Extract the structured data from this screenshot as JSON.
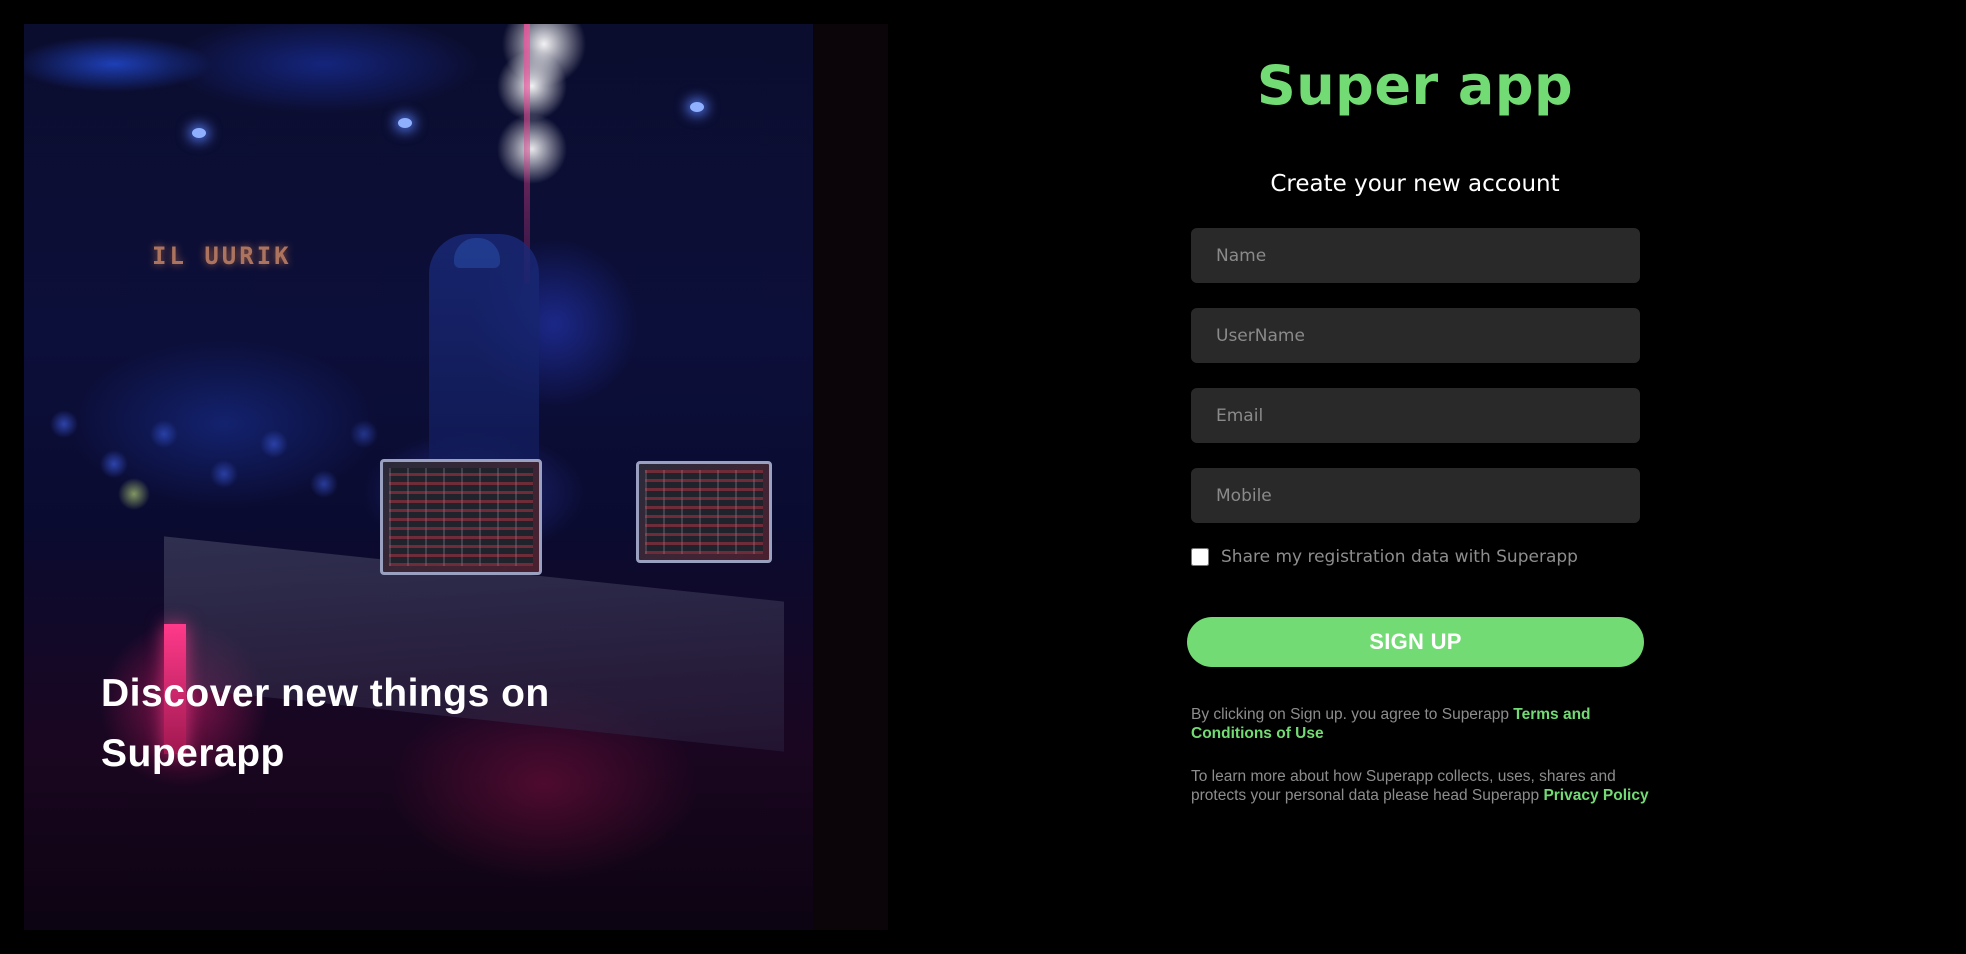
{
  "hero": {
    "title": "Discover new things on Superapp",
    "sign_text": "IL UURIK"
  },
  "brand": {
    "name": "Super app",
    "accent_color": "#72db73"
  },
  "form": {
    "subtitle": "Create your new account",
    "name_placeholder": "Name",
    "username_placeholder": "UserName",
    "email_placeholder": "Email",
    "mobile_placeholder": "Mobile",
    "share_label": "Share my registration data with Superapp",
    "share_checked": false,
    "signup_label": "SIGN UP"
  },
  "legal": {
    "terms_text": "By clicking on Sign up. you agree to Superapp ",
    "terms_link": "Terms and Conditions of Use",
    "privacy_text": "To learn more about how Superapp collects, uses, shares and protects your personal data please head Superapp ",
    "privacy_link": "Privacy Policy"
  },
  "colors": {
    "background": "#000000",
    "input_background": "#292929",
    "muted_text": "#8d8d8d",
    "accent": "#72db73"
  }
}
